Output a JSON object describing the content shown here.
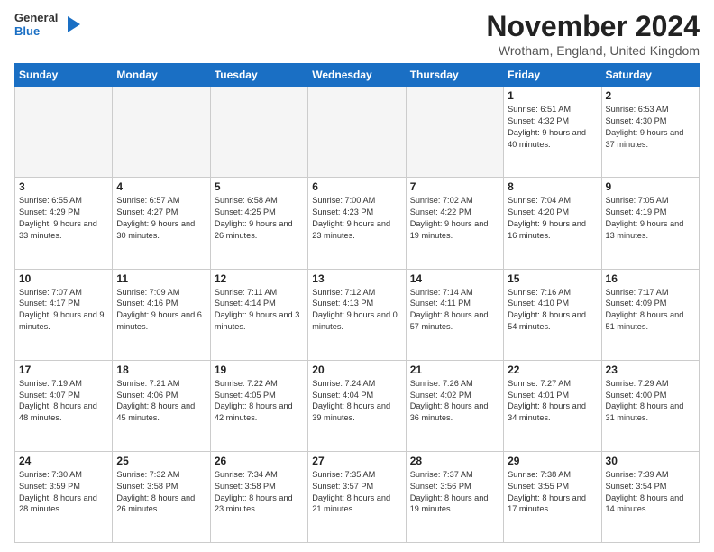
{
  "logo": {
    "general": "General",
    "blue": "Blue"
  },
  "title": "November 2024",
  "location": "Wrotham, England, United Kingdom",
  "days_of_week": [
    "Sunday",
    "Monday",
    "Tuesday",
    "Wednesday",
    "Thursday",
    "Friday",
    "Saturday"
  ],
  "weeks": [
    [
      {
        "day": "",
        "info": ""
      },
      {
        "day": "",
        "info": ""
      },
      {
        "day": "",
        "info": ""
      },
      {
        "day": "",
        "info": ""
      },
      {
        "day": "",
        "info": ""
      },
      {
        "day": "1",
        "info": "Sunrise: 6:51 AM\nSunset: 4:32 PM\nDaylight: 9 hours and 40 minutes."
      },
      {
        "day": "2",
        "info": "Sunrise: 6:53 AM\nSunset: 4:30 PM\nDaylight: 9 hours and 37 minutes."
      }
    ],
    [
      {
        "day": "3",
        "info": "Sunrise: 6:55 AM\nSunset: 4:29 PM\nDaylight: 9 hours and 33 minutes."
      },
      {
        "day": "4",
        "info": "Sunrise: 6:57 AM\nSunset: 4:27 PM\nDaylight: 9 hours and 30 minutes."
      },
      {
        "day": "5",
        "info": "Sunrise: 6:58 AM\nSunset: 4:25 PM\nDaylight: 9 hours and 26 minutes."
      },
      {
        "day": "6",
        "info": "Sunrise: 7:00 AM\nSunset: 4:23 PM\nDaylight: 9 hours and 23 minutes."
      },
      {
        "day": "7",
        "info": "Sunrise: 7:02 AM\nSunset: 4:22 PM\nDaylight: 9 hours and 19 minutes."
      },
      {
        "day": "8",
        "info": "Sunrise: 7:04 AM\nSunset: 4:20 PM\nDaylight: 9 hours and 16 minutes."
      },
      {
        "day": "9",
        "info": "Sunrise: 7:05 AM\nSunset: 4:19 PM\nDaylight: 9 hours and 13 minutes."
      }
    ],
    [
      {
        "day": "10",
        "info": "Sunrise: 7:07 AM\nSunset: 4:17 PM\nDaylight: 9 hours and 9 minutes."
      },
      {
        "day": "11",
        "info": "Sunrise: 7:09 AM\nSunset: 4:16 PM\nDaylight: 9 hours and 6 minutes."
      },
      {
        "day": "12",
        "info": "Sunrise: 7:11 AM\nSunset: 4:14 PM\nDaylight: 9 hours and 3 minutes."
      },
      {
        "day": "13",
        "info": "Sunrise: 7:12 AM\nSunset: 4:13 PM\nDaylight: 9 hours and 0 minutes."
      },
      {
        "day": "14",
        "info": "Sunrise: 7:14 AM\nSunset: 4:11 PM\nDaylight: 8 hours and 57 minutes."
      },
      {
        "day": "15",
        "info": "Sunrise: 7:16 AM\nSunset: 4:10 PM\nDaylight: 8 hours and 54 minutes."
      },
      {
        "day": "16",
        "info": "Sunrise: 7:17 AM\nSunset: 4:09 PM\nDaylight: 8 hours and 51 minutes."
      }
    ],
    [
      {
        "day": "17",
        "info": "Sunrise: 7:19 AM\nSunset: 4:07 PM\nDaylight: 8 hours and 48 minutes."
      },
      {
        "day": "18",
        "info": "Sunrise: 7:21 AM\nSunset: 4:06 PM\nDaylight: 8 hours and 45 minutes."
      },
      {
        "day": "19",
        "info": "Sunrise: 7:22 AM\nSunset: 4:05 PM\nDaylight: 8 hours and 42 minutes."
      },
      {
        "day": "20",
        "info": "Sunrise: 7:24 AM\nSunset: 4:04 PM\nDaylight: 8 hours and 39 minutes."
      },
      {
        "day": "21",
        "info": "Sunrise: 7:26 AM\nSunset: 4:02 PM\nDaylight: 8 hours and 36 minutes."
      },
      {
        "day": "22",
        "info": "Sunrise: 7:27 AM\nSunset: 4:01 PM\nDaylight: 8 hours and 34 minutes."
      },
      {
        "day": "23",
        "info": "Sunrise: 7:29 AM\nSunset: 4:00 PM\nDaylight: 8 hours and 31 minutes."
      }
    ],
    [
      {
        "day": "24",
        "info": "Sunrise: 7:30 AM\nSunset: 3:59 PM\nDaylight: 8 hours and 28 minutes."
      },
      {
        "day": "25",
        "info": "Sunrise: 7:32 AM\nSunset: 3:58 PM\nDaylight: 8 hours and 26 minutes."
      },
      {
        "day": "26",
        "info": "Sunrise: 7:34 AM\nSunset: 3:58 PM\nDaylight: 8 hours and 23 minutes."
      },
      {
        "day": "27",
        "info": "Sunrise: 7:35 AM\nSunset: 3:57 PM\nDaylight: 8 hours and 21 minutes."
      },
      {
        "day": "28",
        "info": "Sunrise: 7:37 AM\nSunset: 3:56 PM\nDaylight: 8 hours and 19 minutes."
      },
      {
        "day": "29",
        "info": "Sunrise: 7:38 AM\nSunset: 3:55 PM\nDaylight: 8 hours and 17 minutes."
      },
      {
        "day": "30",
        "info": "Sunrise: 7:39 AM\nSunset: 3:54 PM\nDaylight: 8 hours and 14 minutes."
      }
    ]
  ]
}
